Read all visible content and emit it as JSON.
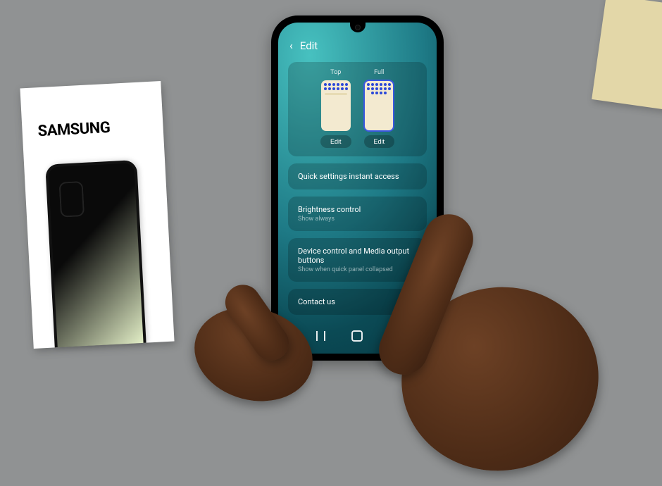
{
  "brand": "SAMSUNG",
  "header": {
    "back_glyph": "‹",
    "title": "Edit"
  },
  "layout_selector": {
    "options": [
      {
        "label": "Top",
        "button": "Edit",
        "selected": false
      },
      {
        "label": "Full",
        "button": "Edit",
        "selected": true
      }
    ]
  },
  "rows": {
    "quick_settings": {
      "title": "Quick settings instant access"
    },
    "brightness": {
      "title": "Brightness control",
      "subtitle": "Show always"
    },
    "device_media": {
      "title": "Device control and Media output buttons",
      "subtitle": "Show when quick panel collapsed"
    },
    "contact": {
      "title": "Contact us"
    }
  }
}
